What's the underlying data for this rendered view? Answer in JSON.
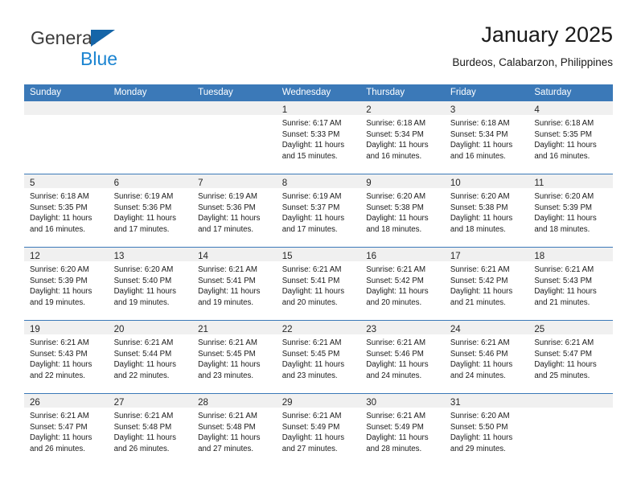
{
  "brand": {
    "name_top": "General",
    "name_bottom": "Blue",
    "triangle_color": "#1565a8",
    "blue_text_color": "#1b84d1"
  },
  "header": {
    "title": "January 2025",
    "subtitle": "Burdeos, Calabarzon, Philippines"
  },
  "theme": {
    "header_blue": "#3b79b8",
    "row_divider": "#3b79b8",
    "daynum_band": "#f0f0f0",
    "text": "#1a1a1a"
  },
  "weekday_headers": [
    "Sunday",
    "Monday",
    "Tuesday",
    "Wednesday",
    "Thursday",
    "Friday",
    "Saturday"
  ],
  "weeks": [
    [
      {
        "day": "",
        "lines": []
      },
      {
        "day": "",
        "lines": []
      },
      {
        "day": "",
        "lines": []
      },
      {
        "day": "1",
        "lines": [
          "Sunrise: 6:17 AM",
          "Sunset: 5:33 PM",
          "Daylight: 11 hours",
          "and 15 minutes."
        ]
      },
      {
        "day": "2",
        "lines": [
          "Sunrise: 6:18 AM",
          "Sunset: 5:34 PM",
          "Daylight: 11 hours",
          "and 16 minutes."
        ]
      },
      {
        "day": "3",
        "lines": [
          "Sunrise: 6:18 AM",
          "Sunset: 5:34 PM",
          "Daylight: 11 hours",
          "and 16 minutes."
        ]
      },
      {
        "day": "4",
        "lines": [
          "Sunrise: 6:18 AM",
          "Sunset: 5:35 PM",
          "Daylight: 11 hours",
          "and 16 minutes."
        ]
      }
    ],
    [
      {
        "day": "5",
        "lines": [
          "Sunrise: 6:18 AM",
          "Sunset: 5:35 PM",
          "Daylight: 11 hours",
          "and 16 minutes."
        ]
      },
      {
        "day": "6",
        "lines": [
          "Sunrise: 6:19 AM",
          "Sunset: 5:36 PM",
          "Daylight: 11 hours",
          "and 17 minutes."
        ]
      },
      {
        "day": "7",
        "lines": [
          "Sunrise: 6:19 AM",
          "Sunset: 5:36 PM",
          "Daylight: 11 hours",
          "and 17 minutes."
        ]
      },
      {
        "day": "8",
        "lines": [
          "Sunrise: 6:19 AM",
          "Sunset: 5:37 PM",
          "Daylight: 11 hours",
          "and 17 minutes."
        ]
      },
      {
        "day": "9",
        "lines": [
          "Sunrise: 6:20 AM",
          "Sunset: 5:38 PM",
          "Daylight: 11 hours",
          "and 18 minutes."
        ]
      },
      {
        "day": "10",
        "lines": [
          "Sunrise: 6:20 AM",
          "Sunset: 5:38 PM",
          "Daylight: 11 hours",
          "and 18 minutes."
        ]
      },
      {
        "day": "11",
        "lines": [
          "Sunrise: 6:20 AM",
          "Sunset: 5:39 PM",
          "Daylight: 11 hours",
          "and 18 minutes."
        ]
      }
    ],
    [
      {
        "day": "12",
        "lines": [
          "Sunrise: 6:20 AM",
          "Sunset: 5:39 PM",
          "Daylight: 11 hours",
          "and 19 minutes."
        ]
      },
      {
        "day": "13",
        "lines": [
          "Sunrise: 6:20 AM",
          "Sunset: 5:40 PM",
          "Daylight: 11 hours",
          "and 19 minutes."
        ]
      },
      {
        "day": "14",
        "lines": [
          "Sunrise: 6:21 AM",
          "Sunset: 5:41 PM",
          "Daylight: 11 hours",
          "and 19 minutes."
        ]
      },
      {
        "day": "15",
        "lines": [
          "Sunrise: 6:21 AM",
          "Sunset: 5:41 PM",
          "Daylight: 11 hours",
          "and 20 minutes."
        ]
      },
      {
        "day": "16",
        "lines": [
          "Sunrise: 6:21 AM",
          "Sunset: 5:42 PM",
          "Daylight: 11 hours",
          "and 20 minutes."
        ]
      },
      {
        "day": "17",
        "lines": [
          "Sunrise: 6:21 AM",
          "Sunset: 5:42 PM",
          "Daylight: 11 hours",
          "and 21 minutes."
        ]
      },
      {
        "day": "18",
        "lines": [
          "Sunrise: 6:21 AM",
          "Sunset: 5:43 PM",
          "Daylight: 11 hours",
          "and 21 minutes."
        ]
      }
    ],
    [
      {
        "day": "19",
        "lines": [
          "Sunrise: 6:21 AM",
          "Sunset: 5:43 PM",
          "Daylight: 11 hours",
          "and 22 minutes."
        ]
      },
      {
        "day": "20",
        "lines": [
          "Sunrise: 6:21 AM",
          "Sunset: 5:44 PM",
          "Daylight: 11 hours",
          "and 22 minutes."
        ]
      },
      {
        "day": "21",
        "lines": [
          "Sunrise: 6:21 AM",
          "Sunset: 5:45 PM",
          "Daylight: 11 hours",
          "and 23 minutes."
        ]
      },
      {
        "day": "22",
        "lines": [
          "Sunrise: 6:21 AM",
          "Sunset: 5:45 PM",
          "Daylight: 11 hours",
          "and 23 minutes."
        ]
      },
      {
        "day": "23",
        "lines": [
          "Sunrise: 6:21 AM",
          "Sunset: 5:46 PM",
          "Daylight: 11 hours",
          "and 24 minutes."
        ]
      },
      {
        "day": "24",
        "lines": [
          "Sunrise: 6:21 AM",
          "Sunset: 5:46 PM",
          "Daylight: 11 hours",
          "and 24 minutes."
        ]
      },
      {
        "day": "25",
        "lines": [
          "Sunrise: 6:21 AM",
          "Sunset: 5:47 PM",
          "Daylight: 11 hours",
          "and 25 minutes."
        ]
      }
    ],
    [
      {
        "day": "26",
        "lines": [
          "Sunrise: 6:21 AM",
          "Sunset: 5:47 PM",
          "Daylight: 11 hours",
          "and 26 minutes."
        ]
      },
      {
        "day": "27",
        "lines": [
          "Sunrise: 6:21 AM",
          "Sunset: 5:48 PM",
          "Daylight: 11 hours",
          "and 26 minutes."
        ]
      },
      {
        "day": "28",
        "lines": [
          "Sunrise: 6:21 AM",
          "Sunset: 5:48 PM",
          "Daylight: 11 hours",
          "and 27 minutes."
        ]
      },
      {
        "day": "29",
        "lines": [
          "Sunrise: 6:21 AM",
          "Sunset: 5:49 PM",
          "Daylight: 11 hours",
          "and 27 minutes."
        ]
      },
      {
        "day": "30",
        "lines": [
          "Sunrise: 6:21 AM",
          "Sunset: 5:49 PM",
          "Daylight: 11 hours",
          "and 28 minutes."
        ]
      },
      {
        "day": "31",
        "lines": [
          "Sunrise: 6:20 AM",
          "Sunset: 5:50 PM",
          "Daylight: 11 hours",
          "and 29 minutes."
        ]
      },
      {
        "day": "",
        "lines": []
      }
    ]
  ]
}
